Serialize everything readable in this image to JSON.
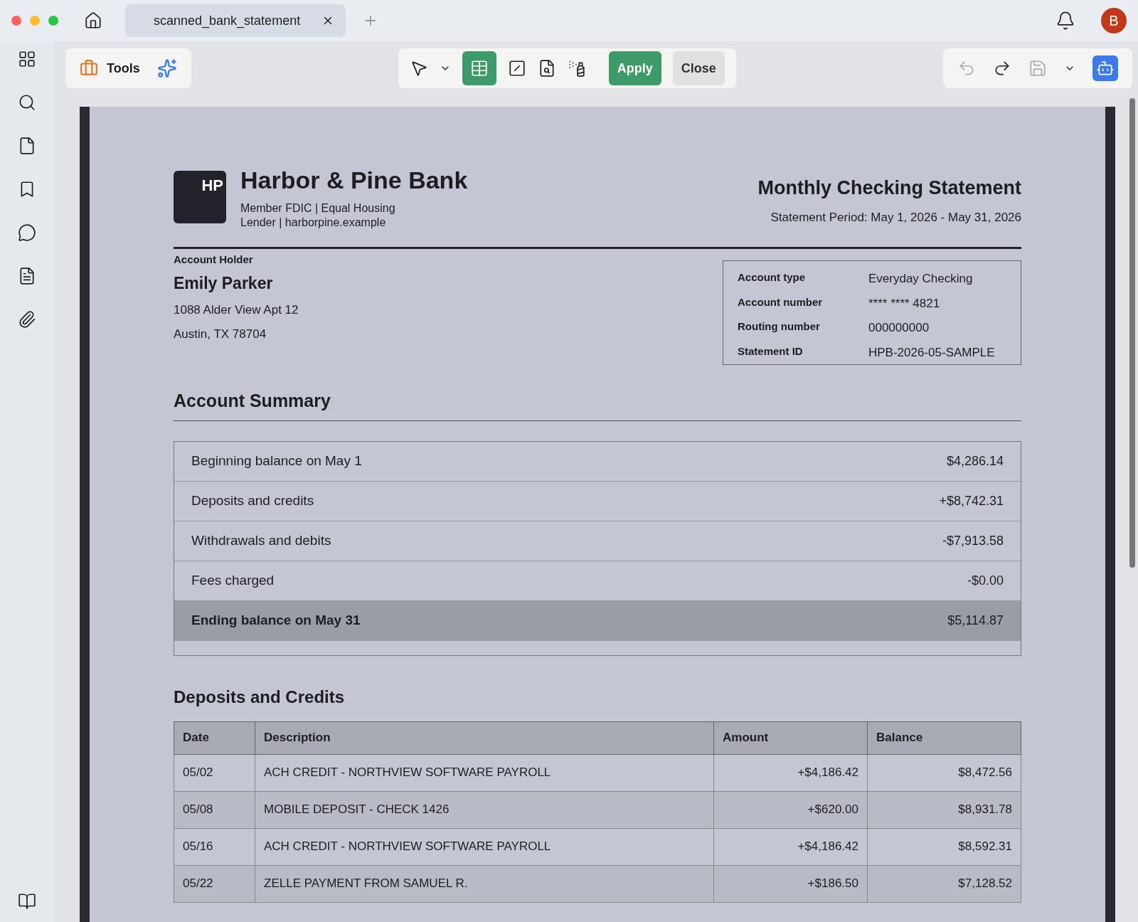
{
  "tab": {
    "title": "scanned_bank_statement",
    "selected": true
  },
  "avatar": {
    "letter": "B"
  },
  "toolbar": {
    "tools_label": "Tools",
    "apply": "Apply",
    "close": "Close"
  },
  "document": {
    "logo": "HP",
    "bank_name": "Harbor & Pine Bank",
    "tagline": "Member FDIC | Equal Housing Lender | harborpine.example",
    "title": "Monthly Checking Statement",
    "period": "Statement Period: May 1, 2026 - May 31, 2026",
    "holder_label": "Account Holder",
    "holder_name": "Emily Parker",
    "address": [
      "1088 Alder View Apt 12",
      "Austin, TX 78704"
    ],
    "details": [
      {
        "label": "Account type",
        "value": "Everyday Checking"
      },
      {
        "label": "Account number",
        "value": "**** **** 4821"
      },
      {
        "label": "Routing number",
        "value": "000000000"
      },
      {
        "label": "Statement ID",
        "value": "HPB-2026-05-SAMPLE"
      }
    ],
    "summary_title": "Account Summary",
    "summary": [
      {
        "kind": "row",
        "label": "Beginning balance on May 1",
        "amount": "$4,286.14"
      },
      {
        "kind": "row",
        "label": "Deposits and credits",
        "amount": "+$8,742.31"
      },
      {
        "kind": "row",
        "label": "Withdrawals and debits",
        "amount": "-$7,913.58"
      },
      {
        "kind": "row",
        "label": "Fees charged",
        "amount": "-$0.00"
      },
      {
        "kind": "total",
        "label": "Ending balance on May 31",
        "amount": "$5,114.87"
      }
    ],
    "deposits_title": "Deposits and Credits",
    "columns": [
      "Date",
      "Description",
      "Amount",
      "Balance"
    ],
    "rows": [
      [
        "05/02",
        "ACH CREDIT - NORTHVIEW SOFTWARE PAYROLL",
        "+$4,186.42",
        "$8,472.56"
      ],
      [
        "05/08",
        "MOBILE DEPOSIT - CHECK 1426",
        "+$620.00",
        "$8,931.78"
      ],
      [
        "05/16",
        "ACH CREDIT - NORTHVIEW SOFTWARE PAYROLL",
        "+$4,186.42",
        "$8,592.31"
      ],
      [
        "05/22",
        "ZELLE PAYMENT FROM SAMUEL R.",
        "+$186.50",
        "$7,128.52"
      ]
    ]
  }
}
